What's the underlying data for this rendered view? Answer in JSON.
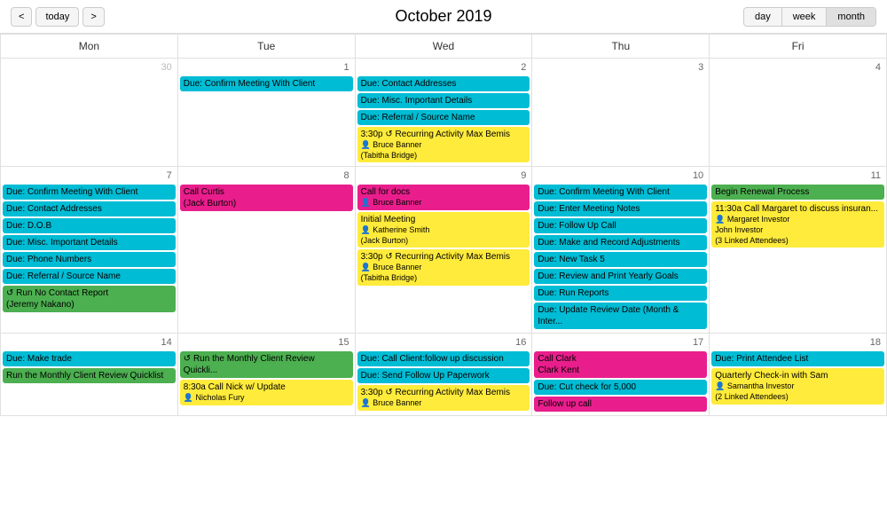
{
  "header": {
    "title": "October 2019",
    "prev_label": "<",
    "next_label": ">",
    "today_label": "today",
    "view_options": [
      "day",
      "week",
      "month"
    ],
    "active_view": "month"
  },
  "days_of_week": [
    "Mon",
    "Tue",
    "Wed",
    "Thu",
    "Fri"
  ],
  "weeks": [
    {
      "cells": [
        {
          "day": "30",
          "other_month": true,
          "events": []
        },
        {
          "day": "1",
          "events": [
            {
              "type": "cyan",
              "text": "Due: Confirm Meeting With Client"
            }
          ]
        },
        {
          "day": "2",
          "events": [
            {
              "type": "cyan",
              "text": "Due: Contact Addresses"
            },
            {
              "type": "cyan",
              "text": "Due: Misc. Important Details"
            },
            {
              "type": "cyan",
              "text": "Due: Referral / Source Name"
            },
            {
              "type": "yellow",
              "text": "3:30p ↺ Recurring Activity Max Bemis",
              "attendee": "Bruce Banner\n(Tabitha Bridge)"
            }
          ]
        },
        {
          "day": "3",
          "events": []
        },
        {
          "day": "4",
          "events": []
        }
      ]
    },
    {
      "cells": [
        {
          "day": "7",
          "events": [
            {
              "type": "cyan",
              "text": "Due: Confirm Meeting With Client"
            },
            {
              "type": "cyan",
              "text": "Due: Contact Addresses"
            },
            {
              "type": "cyan",
              "text": "Due: D.O.B"
            },
            {
              "type": "cyan",
              "text": "Due: Misc. Important Details"
            },
            {
              "type": "cyan",
              "text": "Due: Phone Numbers"
            },
            {
              "type": "cyan",
              "text": "Due: Referral / Source Name"
            },
            {
              "type": "green",
              "text": "↺ Run No Contact Report\n(Jeremy Nakano)"
            }
          ]
        },
        {
          "day": "8",
          "events": [
            {
              "type": "pink",
              "text": "Call Curtis\n(Jack Burton)"
            }
          ]
        },
        {
          "day": "9",
          "events": [
            {
              "type": "pink",
              "text": "Call for docs",
              "attendee": "Bruce Banner"
            },
            {
              "type": "yellow",
              "text": "Initial Meeting",
              "attendee": "Katherine Smith\n(Jack Burton)"
            },
            {
              "type": "yellow",
              "text": "3:30p ↺ Recurring Activity Max Bemis",
              "attendee": "Bruce Banner\n(Tabitha Bridge)"
            }
          ]
        },
        {
          "day": "10",
          "events": [
            {
              "type": "cyan",
              "text": "Due: Confirm Meeting With Client"
            },
            {
              "type": "cyan",
              "text": "Due: Enter Meeting Notes"
            },
            {
              "type": "cyan",
              "text": "Due: Follow Up Call"
            },
            {
              "type": "cyan",
              "text": "Due: Make and Record Adjustments"
            },
            {
              "type": "cyan",
              "text": "Due: New Task 5"
            },
            {
              "type": "cyan",
              "text": "Due: Review and Print Yearly Goals"
            },
            {
              "type": "cyan",
              "text": "Due: Run Reports"
            },
            {
              "type": "cyan",
              "text": "Due: Update Review Date (Month & Inter..."
            }
          ]
        },
        {
          "day": "11",
          "events": [
            {
              "type": "green",
              "text": "Begin Renewal Process"
            },
            {
              "type": "yellow",
              "text": "11:30a Call Margaret to discuss insuran...",
              "attendee": "Margaret Investor\nJohn Investor\n(3 Linked Attendees)"
            }
          ]
        }
      ]
    },
    {
      "cells": [
        {
          "day": "14",
          "events": [
            {
              "type": "cyan",
              "text": "Due: Make trade"
            },
            {
              "type": "green",
              "text": "Run the Monthly Client Review Quicklist"
            }
          ]
        },
        {
          "day": "15",
          "events": [
            {
              "type": "green",
              "text": "↺ Run the Monthly Client Review Quickli..."
            },
            {
              "type": "yellow",
              "text": "8:30a Call Nick w/ Update",
              "attendee": "Nicholas Fury"
            }
          ]
        },
        {
          "day": "16",
          "events": [
            {
              "type": "cyan",
              "text": "Due: Call Client:follow up discussion"
            },
            {
              "type": "cyan",
              "text": "Due: Send Follow Up Paperwork"
            },
            {
              "type": "yellow",
              "text": "3:30p ↺ Recurring Activity Max Bemis",
              "attendee": "Bruce Banner"
            }
          ]
        },
        {
          "day": "17",
          "events": [
            {
              "type": "pink",
              "text": "Call Clark\nClark Kent"
            },
            {
              "type": "cyan",
              "text": "Due: Cut check for 5,000"
            },
            {
              "type": "pink",
              "text": "Follow up call"
            }
          ]
        },
        {
          "day": "18",
          "events": [
            {
              "type": "cyan",
              "text": "Due: Print Attendee List"
            },
            {
              "type": "yellow",
              "text": "Quarterly Check-in with Sam",
              "attendee": "Samantha Investor\n(2 Linked Attendees)"
            }
          ]
        }
      ]
    }
  ],
  "colors": {
    "cyan": "#00bcd4",
    "yellow": "#ffeb3b",
    "green": "#4caf50",
    "pink": "#e91e8c",
    "cell_border": "#e0e0e0"
  }
}
